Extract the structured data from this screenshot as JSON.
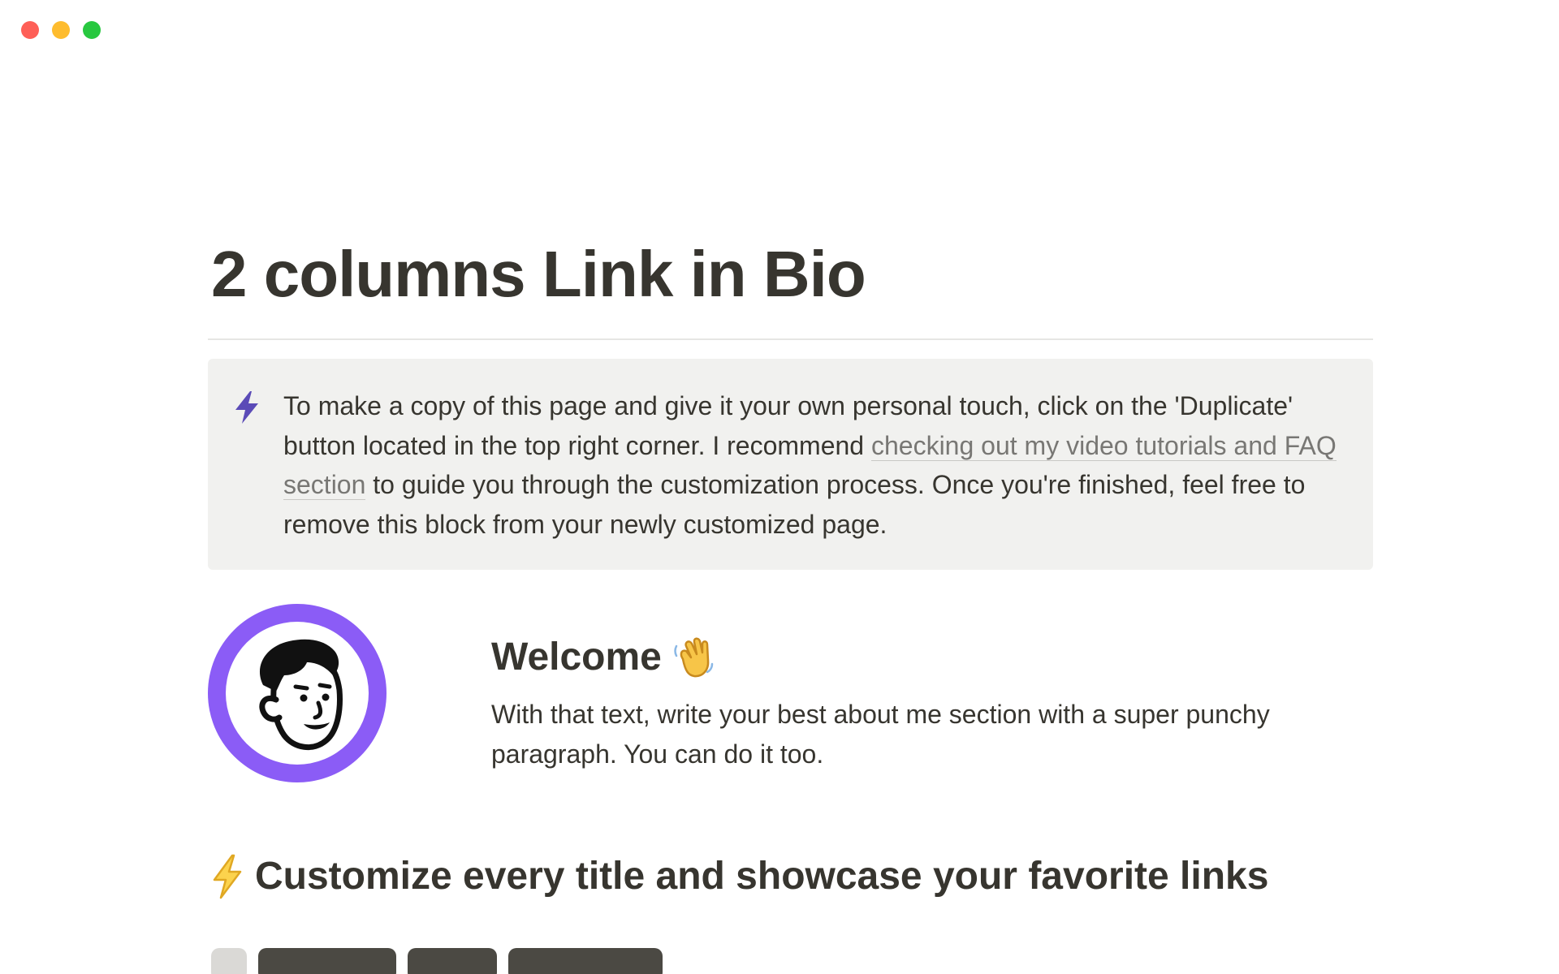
{
  "window": {
    "controls": [
      "close",
      "minimize",
      "zoom"
    ]
  },
  "page": {
    "title": "2 columns Link in Bio"
  },
  "callout": {
    "icon": "lightning-bolt-icon",
    "text_before": "To make a copy of this page and give it your own personal touch, click on the 'Duplicate' button located in the top right corner. I recommend ",
    "link_text": "checking out my video tutorials and FAQ section",
    "text_after": " to guide you through the customization process. Once you're finished, feel free to remove this block from your newly customized page."
  },
  "profile": {
    "avatar_icon": "cartoon-face-avatar",
    "ring_color": "#8b5cf6"
  },
  "welcome": {
    "title": "Welcome",
    "emoji": "waving-hand-icon",
    "body": "With that text, write your best about me section with a super punchy paragraph. You can do it too."
  },
  "section": {
    "emoji": "high-voltage-icon",
    "heading": "Customize every title and showcase your favorite links"
  },
  "colors": {
    "text": "#37352f",
    "link": "#787774",
    "callout_bg": "#f1f1ef",
    "accent": "#8b5cf6",
    "bolt_purple": "#5b4bb7"
  }
}
